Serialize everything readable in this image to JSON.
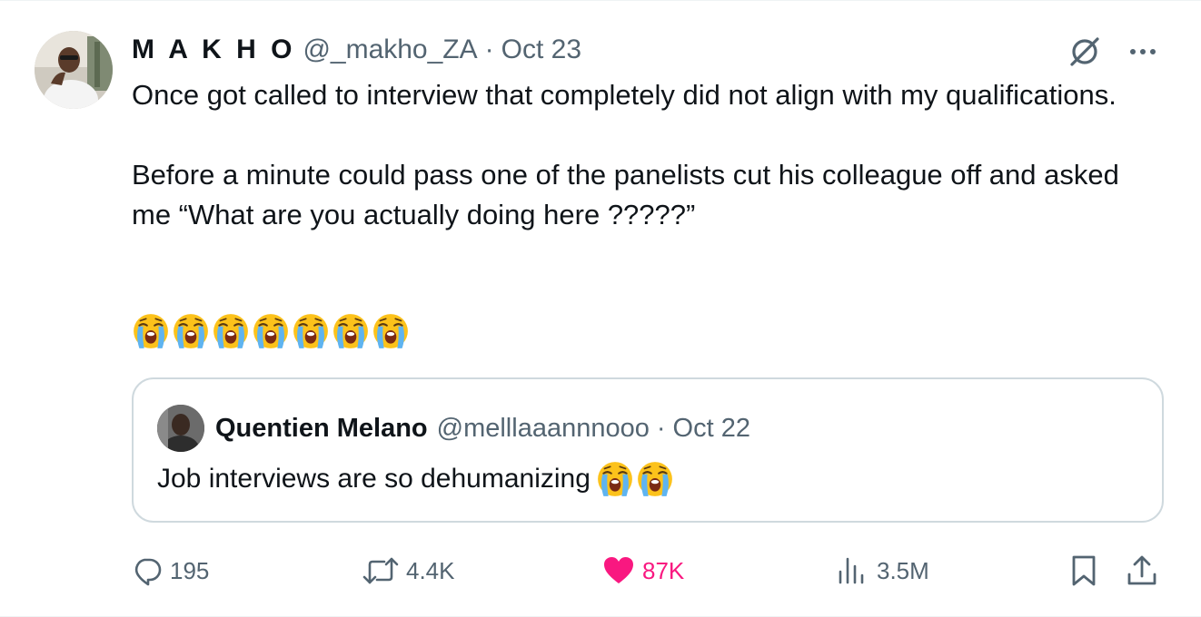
{
  "post": {
    "author": {
      "display_name": "M A K H O",
      "handle": "@_makho_ZA",
      "separator": "·",
      "date": "Oct 23",
      "avatar_icon": "user-photo-avatar"
    },
    "text_paragraphs": [
      "Once got called to interview that completely did not align with my qualifications.",
      "Before a minute could pass one of the panelists cut his colleague off and asked me “What are you actually doing here ?????”"
    ],
    "emoji": {
      "name": "loudly-crying-face-icon",
      "count": 7
    },
    "top_icons": [
      "grok-icon",
      "more-options-icon"
    ]
  },
  "quote": {
    "display_name": "Quentien Melano",
    "handle": "@melllaaannnooo",
    "separator": "·",
    "date": "Oct 22",
    "text": "Job interviews are so dehumanizing",
    "emoji_count": 2
  },
  "actions": {
    "replies": "195",
    "reposts": "4.4K",
    "likes": "87K",
    "views": "3.5M"
  },
  "colors": {
    "text": "#0f1419",
    "secondary": "#536471",
    "like": "#f91880",
    "border": "#cfd9de"
  }
}
